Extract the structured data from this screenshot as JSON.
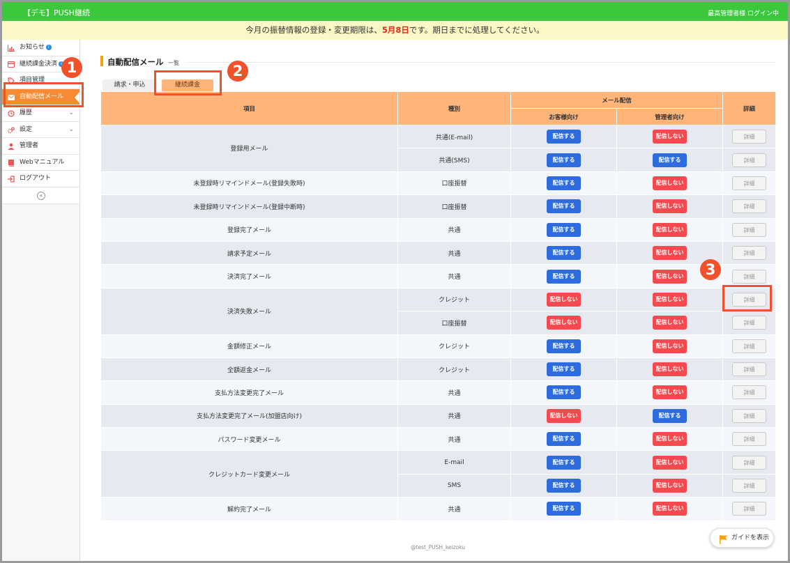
{
  "header": {
    "app_title": "【デモ】PUSH継続",
    "user_status": "最高管理者様 ログイン中"
  },
  "notice": {
    "prefix": "今月の振替情報の登録・変更期限は、",
    "deadline": "5月8日",
    "suffix": "です。期日までに処理してください。"
  },
  "sidebar": {
    "items": [
      {
        "label": "お知らせ",
        "icon": "bar-chart-icon"
      },
      {
        "label": "継続課金決済",
        "icon": "card-icon"
      },
      {
        "label": "項目管理",
        "icon": "tags-icon"
      },
      {
        "label": "自動配信メール",
        "icon": "envelope-icon"
      },
      {
        "label": "履歴",
        "icon": "history-icon"
      },
      {
        "label": "設定",
        "icon": "gears-icon"
      },
      {
        "label": "管理者",
        "icon": "user-icon"
      },
      {
        "label": "Webマニュアル",
        "icon": "book-icon"
      },
      {
        "label": "ログアウト",
        "icon": "logout-icon"
      }
    ],
    "collapse_glyph": "«"
  },
  "markers": {
    "one": "1",
    "two": "2",
    "three": "3"
  },
  "page": {
    "title": "自動配信メール",
    "subtitle": "一覧"
  },
  "tabs": [
    {
      "label": "請求・申込"
    },
    {
      "label": "継続課金"
    }
  ],
  "table": {
    "headers": {
      "item": "項目",
      "type": "種別",
      "mail": "メール配信",
      "customer": "お客様向け",
      "admin": "管理者向け",
      "detail": "詳細"
    },
    "send_label": "配信する",
    "nosend_label": "配信しない",
    "detail_label": "詳細",
    "groups": [
      {
        "name": "登録用メール",
        "rows": [
          {
            "type": "共通(E-mail)",
            "customer": true,
            "admin": false
          },
          {
            "type": "共通(SMS)",
            "customer": true,
            "admin": true
          }
        ]
      },
      {
        "name": "未登録時リマインドメール(登録失敗時)",
        "rows": [
          {
            "type": "口座振替",
            "customer": true,
            "admin": false
          }
        ]
      },
      {
        "name": "未登録時リマインドメール(登録中断時)",
        "rows": [
          {
            "type": "口座振替",
            "customer": true,
            "admin": false
          }
        ]
      },
      {
        "name": "登録完了メール",
        "rows": [
          {
            "type": "共通",
            "customer": true,
            "admin": false
          }
        ]
      },
      {
        "name": "請求予定メール",
        "rows": [
          {
            "type": "共通",
            "customer": true,
            "admin": false
          }
        ]
      },
      {
        "name": "決済完了メール",
        "rows": [
          {
            "type": "共通",
            "customer": true,
            "admin": false
          }
        ]
      },
      {
        "name": "決済失敗メール",
        "rows": [
          {
            "type": "クレジット",
            "customer": false,
            "admin": false
          },
          {
            "type": "口座振替",
            "customer": false,
            "admin": false
          }
        ]
      },
      {
        "name": "金額修正メール",
        "rows": [
          {
            "type": "クレジット",
            "customer": true,
            "admin": false
          }
        ]
      },
      {
        "name": "全額返金メール",
        "rows": [
          {
            "type": "クレジット",
            "customer": true,
            "admin": false
          }
        ]
      },
      {
        "name": "支払方法変更完了メール",
        "rows": [
          {
            "type": "共通",
            "customer": true,
            "admin": false
          }
        ]
      },
      {
        "name": "支払方法変更完了メール(加盟店向け)",
        "rows": [
          {
            "type": "共通",
            "customer": false,
            "admin": true
          }
        ]
      },
      {
        "name": "パスワード変更メール",
        "rows": [
          {
            "type": "共通",
            "customer": true,
            "admin": false
          }
        ]
      },
      {
        "name": "クレジットカード変更メール",
        "rows": [
          {
            "type": "E-mail",
            "customer": true,
            "admin": false
          },
          {
            "type": "SMS",
            "customer": true,
            "admin": false
          }
        ]
      },
      {
        "name": "解約完了メール",
        "rows": [
          {
            "type": "共通",
            "customer": true,
            "admin": false
          }
        ]
      }
    ]
  },
  "footer": {
    "account": "@test_PUSH_keizoku"
  },
  "guide_button": {
    "label": "ガイドを表示"
  },
  "colors": {
    "topbar": "#3cc83c",
    "accent_orange": "#f68b34",
    "header_orange": "#ffb47a",
    "send_blue": "#2e6cdd",
    "nosend_red": "#f44a4f",
    "annotation_red": "#f0502a"
  }
}
